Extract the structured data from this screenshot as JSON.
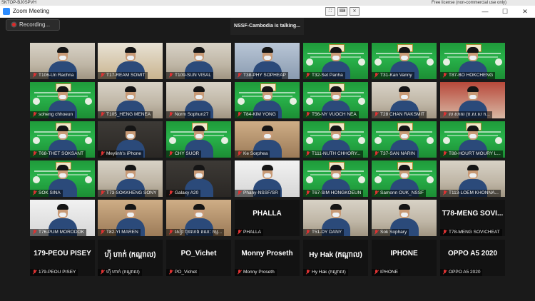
{
  "window": {
    "top_left_text": "SKTOP-BJ0SPVH",
    "top_right_text": "Free license (non-commercial use only)",
    "title": "Zoom Meeting",
    "minimize": "—",
    "maximize": "☐",
    "close": "✕"
  },
  "recording": {
    "label": "Recording..."
  },
  "speaker_banner": {
    "text": "NSSF-Cambodia is talking..."
  },
  "participants": [
    [
      {
        "label": "T106-Un Rachna",
        "style": "room",
        "person": true
      },
      {
        "label": "T17-REAM SOMIT",
        "style": "flag",
        "person": true
      },
      {
        "label": "T109-SUN VISAL",
        "style": "room",
        "person": true
      },
      {
        "label": "T38-PHY SOPHEAP",
        "style": "blue",
        "person": true
      },
      {
        "label": "T32-Set Panha",
        "style": "green",
        "person": true
      },
      {
        "label": "T31-Kan Vanny",
        "style": "green",
        "person": true
      },
      {
        "label": "T87-BO HOKCHENG",
        "style": "green",
        "person": true
      }
    ],
    [
      {
        "label": "soheng chhoeun",
        "style": "green",
        "person": true
      },
      {
        "label": "T105_HENG MENEA",
        "style": "room",
        "person": true
      },
      {
        "label": "Norm Sophun27",
        "style": "room",
        "person": true
      },
      {
        "label": "T84-KIM YONG",
        "style": "green",
        "person": true
      },
      {
        "label": "T56-NY VUOCH NEA",
        "style": "green",
        "person": true
      },
      {
        "label": "T28 CHAN RAKSMIT",
        "style": "room",
        "person": true
      },
      {
        "label": "ល សាគរ (ប.ស.ស ក...",
        "style": "red",
        "person": true
      }
    ],
    [
      {
        "label": "T68-THET SOKSANT",
        "style": "green",
        "person": true
      },
      {
        "label": "Meylinh's iPhone",
        "style": "dark",
        "person": true
      },
      {
        "label": "CHY SUOR",
        "style": "green",
        "person": true
      },
      {
        "label": "Ke Sorphea",
        "style": "warm",
        "person": true
      },
      {
        "label": "T111-NUTH CHHORY...",
        "style": "green",
        "person": true
      },
      {
        "label": "T37-SAN NARIN",
        "style": "green",
        "person": true
      },
      {
        "label": "T88-HOURT MOURY L...",
        "style": "green",
        "person": true
      }
    ],
    [
      {
        "label": "SOK SINA",
        "style": "green",
        "person": true
      },
      {
        "label": "T73-SOKKHENG SONY",
        "style": "room",
        "person": true
      },
      {
        "label": "Galaxy A20",
        "style": "dark",
        "person": true
      },
      {
        "label": "Phany-NSSF/SR",
        "style": "white",
        "person": true
      },
      {
        "label": "T67-SIM HONGKOEUN",
        "style": "green",
        "person": true
      },
      {
        "label": "Samonn OUK_NSSF",
        "style": "green",
        "person": true
      },
      {
        "label": "T113-LOEM KHONNA...",
        "style": "room",
        "person": true
      }
    ],
    [
      {
        "label": "T76-PUM MORODOK",
        "style": "white",
        "person": true
      },
      {
        "label": "T82-YI MAREN",
        "style": "warm",
        "person": true
      },
      {
        "label": "សៀវ ប៊ុនហេង គណៈ កម្ម...",
        "style": "warm",
        "person": true
      },
      {
        "label": "PHALLA",
        "style": "none",
        "person": false,
        "big": "PHALLA"
      },
      {
        "label": "T51-DY DANY",
        "style": "room",
        "person": true
      },
      {
        "label": "Sok Sophary",
        "style": "room",
        "person": true
      },
      {
        "label": "T78-MENG SOVICHEAT",
        "style": "none",
        "person": false,
        "big": "T78-MENG  SOVI..."
      }
    ],
    [
      {
        "label": "179-PEOU PISEY",
        "style": "none",
        "person": false,
        "big": "179-PEOU PISEY"
      },
      {
        "label": "ហ៊ី ហាក់ (កណ្ដាល)",
        "style": "none",
        "person": false,
        "big": "ហ៊ី ហាក់ (កណ្ដាល)"
      },
      {
        "label": "PO_Vichet",
        "style": "none",
        "person": false,
        "big": "PO_Vichet"
      },
      {
        "label": "Monny Proseth",
        "style": "none",
        "person": false,
        "big": "Monny Proseth"
      },
      {
        "label": "Hy Hak (កណ្ដាល)",
        "style": "none",
        "person": false,
        "big": "Hy Hak (កណ្ដាល)"
      },
      {
        "label": "IPHONE",
        "style": "none",
        "person": false,
        "big": "IPHONE"
      },
      {
        "label": "OPPO A5 2020",
        "style": "none",
        "person": false,
        "big": "OPPO A5 2020"
      }
    ]
  ]
}
